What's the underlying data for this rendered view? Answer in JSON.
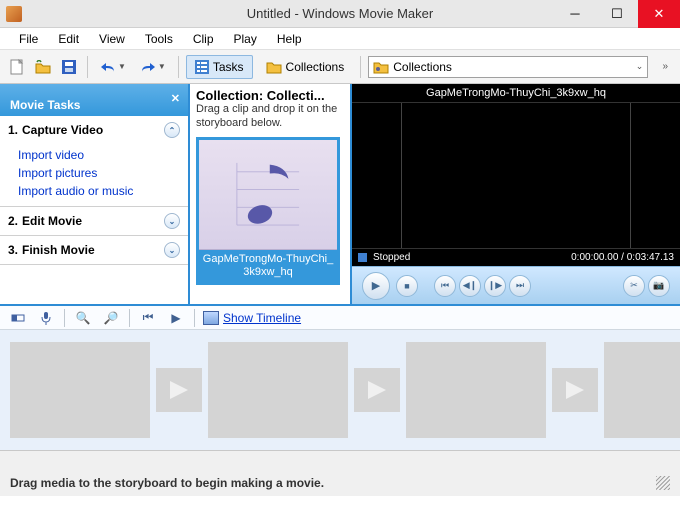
{
  "window": {
    "title": "Untitled - Windows Movie Maker"
  },
  "menu": {
    "items": [
      "File",
      "Edit",
      "View",
      "Tools",
      "Clip",
      "Play",
      "Help"
    ]
  },
  "toolbar": {
    "tasks_label": "Tasks",
    "collections_label": "Collections",
    "collection_combo": "Collections"
  },
  "tasks": {
    "header": "Movie Tasks",
    "sections": [
      {
        "num": "1.",
        "title": "Capture Video",
        "expanded": true,
        "links": [
          "Import video",
          "Import pictures",
          "Import audio or music"
        ]
      },
      {
        "num": "2.",
        "title": "Edit Movie",
        "expanded": false,
        "links": []
      },
      {
        "num": "3.",
        "title": "Finish Movie",
        "expanded": false,
        "links": []
      }
    ]
  },
  "collection": {
    "title": "Collection: Collecti...",
    "hint": "Drag a clip and drop it on the storyboard below.",
    "clip_name": "GapMeTrongMo-ThuyChi_3k9xw_hq"
  },
  "preview": {
    "title": "GapMeTrongMo-ThuyChi_3k9xw_hq",
    "status": "Stopped",
    "time": "0:00:00.00 / 0:03:47.13"
  },
  "storyboard_toolbar": {
    "show_timeline": "Show Timeline"
  },
  "statusbar": {
    "message": "Drag media to the storyboard to begin making a movie."
  }
}
